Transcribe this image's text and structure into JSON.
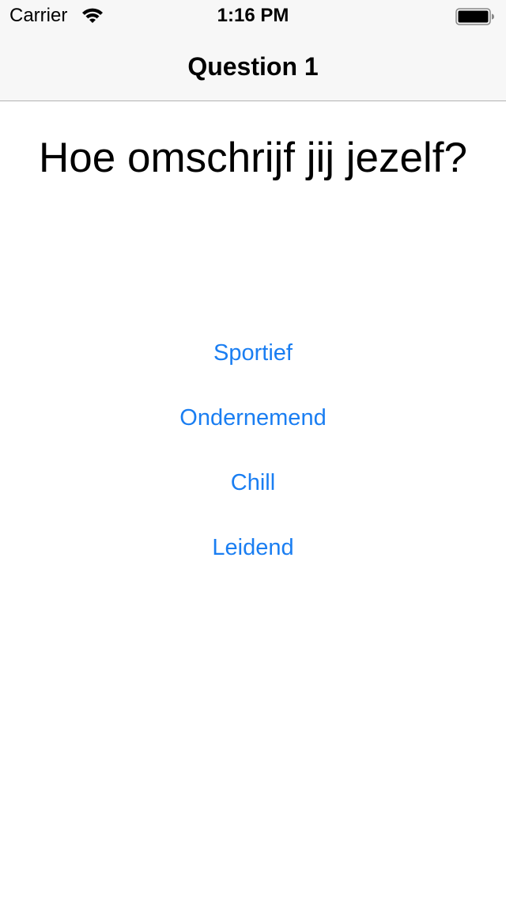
{
  "status_bar": {
    "carrier": "Carrier",
    "time": "1:16 PM",
    "icons": [
      "wifi-icon",
      "battery-icon"
    ]
  },
  "nav": {
    "title": "Question 1"
  },
  "question": {
    "text": "Hoe omschrijf jij jezelf?"
  },
  "answers": [
    {
      "label": "Sportief"
    },
    {
      "label": "Ondernemend"
    },
    {
      "label": "Chill"
    },
    {
      "label": "Leidend"
    }
  ],
  "colors": {
    "accent": "#1a7ef2",
    "navbar_bg": "#f7f7f7",
    "text": "#000000"
  }
}
